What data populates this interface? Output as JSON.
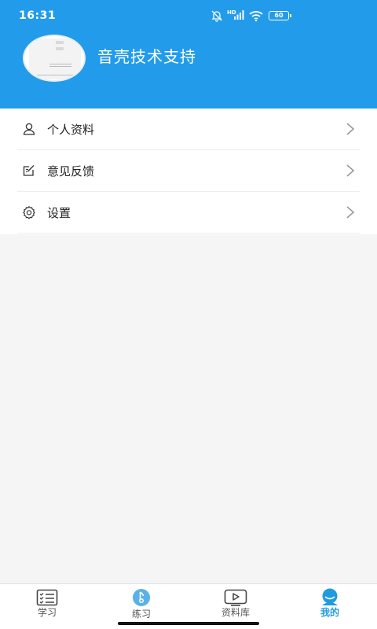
{
  "status_bar": {
    "time": "16:31",
    "network_label": "HD",
    "battery": "60",
    "icons": [
      "mute-bell-icon",
      "signal-icon",
      "wifi-icon",
      "battery-icon"
    ]
  },
  "profile": {
    "name": "音壳技术支持"
  },
  "menu": {
    "items": [
      {
        "label": "个人资料",
        "icon": "user-icon"
      },
      {
        "label": "意见反馈",
        "icon": "feedback-icon"
      },
      {
        "label": "设置",
        "icon": "gear-icon"
      }
    ]
  },
  "tabbar": {
    "tabs": [
      {
        "label": "学习",
        "icon": "checklist-icon",
        "active": false
      },
      {
        "label": "练习",
        "icon": "music-note-icon",
        "active": false
      },
      {
        "label": "资料库",
        "icon": "video-icon",
        "active": false
      },
      {
        "label": "我的",
        "icon": "person-icon",
        "active": true
      }
    ]
  },
  "colors": {
    "header_bg": "#229cea",
    "accent": "#1f9be0",
    "page_bg": "#f5f5f5"
  }
}
